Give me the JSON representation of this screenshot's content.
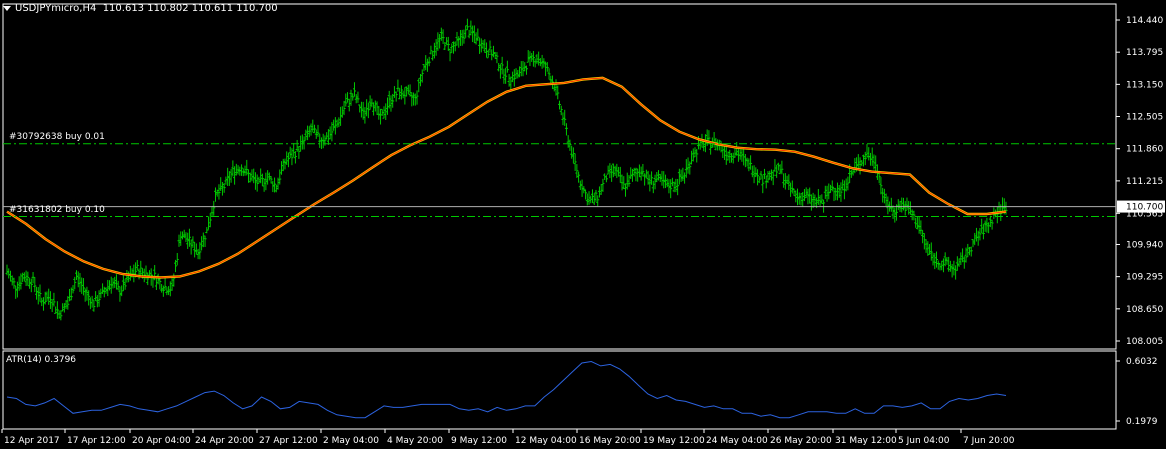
{
  "header": {
    "symbol": "USDJPYmicro,H4",
    "ohlc": "110.613 110.802 110.611 110.700"
  },
  "orders": [
    {
      "label": "#30792638 buy 0.01",
      "price": 111.96
    },
    {
      "label": "#31631802 buy 0.10",
      "price": 110.5
    }
  ],
  "colors": {
    "background": "#000000",
    "candle": "#00c800",
    "ma_outer": "#ffd400",
    "ma_inner": "#ff3a00",
    "order_line": "#00c800",
    "atr_line": "#2c63e0",
    "grid": "#ffffff"
  },
  "chart_data": [
    {
      "type": "line",
      "title": "USDJPYmicro,H4",
      "ylim": [
        108.005,
        114.44
      ],
      "y_ticks": [
        "114.440",
        "113.795",
        "113.150",
        "112.505",
        "111.860",
        "111.215",
        "110.565",
        "109.940",
        "109.295",
        "108.650",
        "108.005"
      ],
      "current_price": "110.700",
      "x_tick_labels": [
        "12 Apr 2017",
        "17 Apr 12:00",
        "20 Apr 04:00",
        "24 Apr 20:00",
        "27 Apr 12:00",
        "2 May 04:00",
        "4 May 20:00",
        "9 May 12:00",
        "12 May 04:00",
        "16 May 20:00",
        "19 May 12:00",
        "24 May 04:00",
        "26 May 20:00",
        "31 May 12:00",
        "5 Jun 04:00",
        "7 Jun 20:00"
      ],
      "series": [
        {
          "values": [
            109.4,
            109.1,
            109.3,
            109.2,
            108.8,
            108.9,
            108.55,
            108.75,
            109.3,
            109.0,
            108.75,
            108.95,
            109.2,
            109.0,
            109.25,
            109.45,
            109.35,
            109.3,
            109.1,
            109.05,
            110.15,
            110.0,
            109.8,
            110.2,
            110.9,
            111.1,
            111.4,
            111.5,
            111.3,
            111.15,
            111.3,
            111.1,
            111.6,
            111.75,
            111.95,
            112.25,
            112.05,
            112.1,
            112.35,
            112.75,
            112.95,
            112.55,
            112.85,
            112.45,
            112.8,
            113.0,
            112.95,
            112.85,
            113.5,
            113.8,
            114.1,
            113.85,
            114.0,
            114.25,
            114.1,
            113.9,
            113.75,
            113.45,
            113.3,
            113.35,
            113.6,
            113.7,
            113.5,
            113.15,
            112.5,
            111.8,
            111.2,
            110.8,
            110.9,
            111.3,
            111.45,
            111.1,
            111.3,
            111.45,
            111.2,
            111.25,
            111.1,
            111.15,
            111.35,
            111.75,
            111.95,
            112.0,
            111.95,
            111.75,
            111.8,
            111.6,
            111.45,
            111.25,
            111.35,
            111.45,
            111.1,
            110.9,
            110.9,
            110.8,
            110.8,
            111.1,
            111.0,
            111.3,
            111.55,
            111.75,
            111.6,
            110.85,
            110.6,
            110.75,
            110.6,
            110.3,
            109.85,
            109.6,
            109.55,
            109.45,
            109.6,
            109.9,
            110.15,
            110.35,
            110.6,
            110.7
          ]
        },
        {
          "values": [
            110.6,
            110.35,
            110.05,
            109.8,
            109.6,
            109.45,
            109.35,
            109.3,
            109.28,
            109.3,
            109.4,
            109.55,
            109.75,
            110.0,
            110.25,
            110.5,
            110.75,
            110.98,
            111.22,
            111.48,
            111.73,
            111.93,
            112.1,
            112.3,
            112.55,
            112.8,
            113.0,
            113.12,
            113.15,
            113.18,
            113.25,
            113.28,
            113.1,
            112.75,
            112.43,
            112.2,
            112.05,
            111.95,
            111.88,
            111.85,
            111.84,
            111.8,
            111.7,
            111.58,
            111.47,
            111.4,
            111.37,
            111.34,
            110.98,
            110.75,
            110.55,
            110.55,
            110.6
          ]
        }
      ]
    },
    {
      "type": "line",
      "title": "ATR(14) 0.3796",
      "ylim": [
        0.1979,
        0.6032
      ],
      "y_ticks": [
        "0.6032",
        "0.1979"
      ],
      "series": [
        {
          "values": [
            0.36,
            0.35,
            0.31,
            0.3,
            0.32,
            0.35,
            0.3,
            0.25,
            0.26,
            0.27,
            0.27,
            0.29,
            0.31,
            0.3,
            0.28,
            0.27,
            0.26,
            0.28,
            0.3,
            0.33,
            0.36,
            0.39,
            0.4,
            0.37,
            0.32,
            0.28,
            0.3,
            0.36,
            0.33,
            0.28,
            0.29,
            0.33,
            0.32,
            0.31,
            0.27,
            0.24,
            0.23,
            0.22,
            0.22,
            0.26,
            0.3,
            0.29,
            0.29,
            0.3,
            0.31,
            0.31,
            0.31,
            0.31,
            0.28,
            0.27,
            0.28,
            0.26,
            0.29,
            0.27,
            0.28,
            0.3,
            0.3,
            0.36,
            0.41,
            0.47,
            0.53,
            0.59,
            0.6,
            0.57,
            0.58,
            0.55,
            0.5,
            0.44,
            0.38,
            0.35,
            0.37,
            0.34,
            0.33,
            0.31,
            0.29,
            0.3,
            0.28,
            0.28,
            0.25,
            0.25,
            0.23,
            0.24,
            0.22,
            0.22,
            0.24,
            0.26,
            0.26,
            0.26,
            0.25,
            0.25,
            0.28,
            0.25,
            0.25,
            0.3,
            0.3,
            0.29,
            0.3,
            0.32,
            0.28,
            0.28,
            0.33,
            0.35,
            0.34,
            0.35,
            0.37,
            0.38,
            0.37
          ]
        }
      ]
    }
  ]
}
